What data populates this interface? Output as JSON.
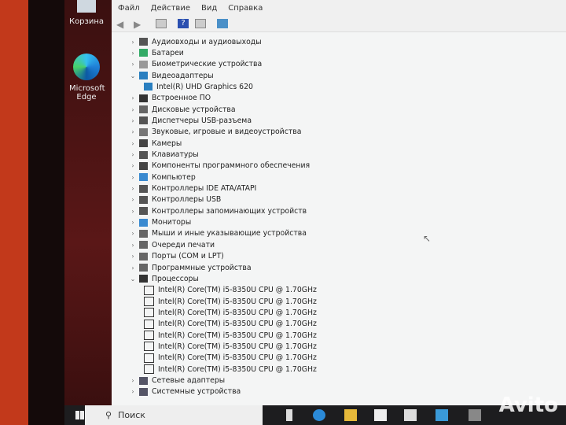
{
  "desktop": {
    "icons": [
      {
        "label": "Корзина",
        "icon": "recycle-bin-icon"
      },
      {
        "label": "Microsoft Edge",
        "icon": "edge-icon"
      }
    ]
  },
  "menu": [
    "Файл",
    "Действие",
    "Вид",
    "Справка"
  ],
  "tree": [
    {
      "label": "Аудиовходы и аудиовыходы",
      "level": 0,
      "expanded": false
    },
    {
      "label": "Батареи",
      "level": 0,
      "expanded": false
    },
    {
      "label": "Биометрические устройства",
      "level": 0,
      "expanded": false
    },
    {
      "label": "Видеоадаптеры",
      "level": 0,
      "expanded": true
    },
    {
      "label": "Intel(R) UHD Graphics 620",
      "level": 1
    },
    {
      "label": "Встроенное ПО",
      "level": 0,
      "expanded": false
    },
    {
      "label": "Дисковые устройства",
      "level": 0,
      "expanded": false
    },
    {
      "label": "Диспетчеры USB-разъема",
      "level": 0,
      "expanded": false
    },
    {
      "label": "Звуковые, игровые и видеоустройства",
      "level": 0,
      "expanded": false
    },
    {
      "label": "Камеры",
      "level": 0,
      "expanded": false
    },
    {
      "label": "Клавиатуры",
      "level": 0,
      "expanded": false
    },
    {
      "label": "Компоненты программного обеспечения",
      "level": 0,
      "expanded": false
    },
    {
      "label": "Компьютер",
      "level": 0,
      "expanded": false
    },
    {
      "label": "Контроллеры IDE ATA/ATAPI",
      "level": 0,
      "expanded": false
    },
    {
      "label": "Контроллеры USB",
      "level": 0,
      "expanded": false
    },
    {
      "label": "Контроллеры запоминающих устройств",
      "level": 0,
      "expanded": false
    },
    {
      "label": "Мониторы",
      "level": 0,
      "expanded": false
    },
    {
      "label": "Мыши и иные указывающие устройства",
      "level": 0,
      "expanded": false
    },
    {
      "label": "Очереди печати",
      "level": 0,
      "expanded": false
    },
    {
      "label": "Порты (COM и LPT)",
      "level": 0,
      "expanded": false
    },
    {
      "label": "Программные устройства",
      "level": 0,
      "expanded": false
    },
    {
      "label": "Процессоры",
      "level": 0,
      "expanded": true
    },
    {
      "label": "Intel(R) Core(TM) i5-8350U CPU @ 1.70GHz",
      "level": 1
    },
    {
      "label": "Intel(R) Core(TM) i5-8350U CPU @ 1.70GHz",
      "level": 1
    },
    {
      "label": "Intel(R) Core(TM) i5-8350U CPU @ 1.70GHz",
      "level": 1
    },
    {
      "label": "Intel(R) Core(TM) i5-8350U CPU @ 1.70GHz",
      "level": 1
    },
    {
      "label": "Intel(R) Core(TM) i5-8350U CPU @ 1.70GHz",
      "level": 1
    },
    {
      "label": "Intel(R) Core(TM) i5-8350U CPU @ 1.70GHz",
      "level": 1
    },
    {
      "label": "Intel(R) Core(TM) i5-8350U CPU @ 1.70GHz",
      "level": 1
    },
    {
      "label": "Intel(R) Core(TM) i5-8350U CPU @ 1.70GHz",
      "level": 1
    },
    {
      "label": "Сетевые адаптеры",
      "level": 0,
      "expanded": false
    },
    {
      "label": "Системные устройства",
      "level": 0,
      "expanded": false
    }
  ],
  "taskbar": {
    "search_placeholder": "Поиск"
  },
  "watermark": "Avito"
}
